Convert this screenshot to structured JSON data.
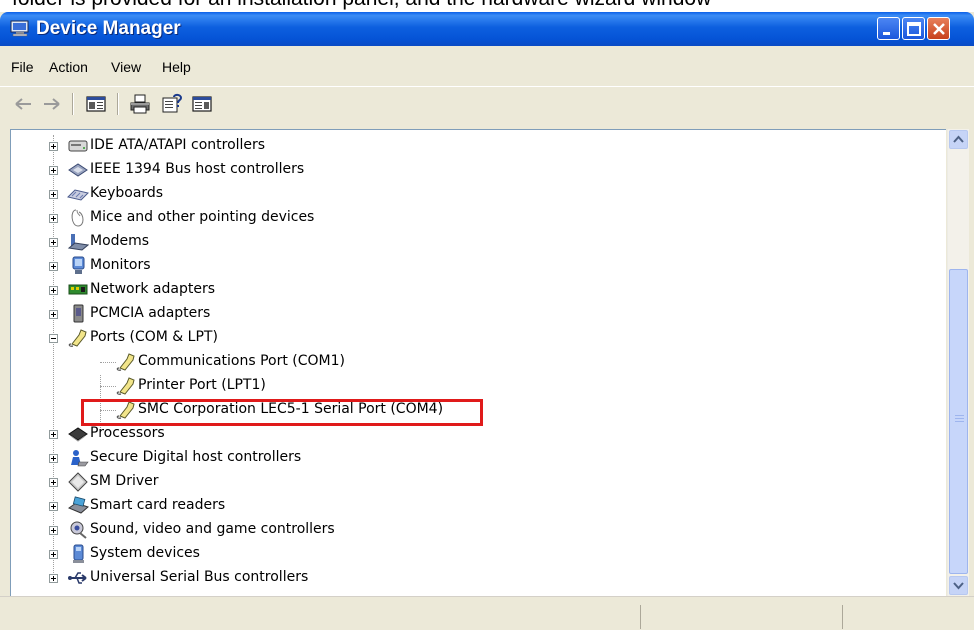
{
  "caption_fragment": "folder is provided for an installation panel, and the hardware wizard window",
  "window": {
    "title": "Device Manager",
    "icon": "computer-monitor-icon",
    "caption_buttons": [
      "minimize",
      "maximize",
      "close"
    ]
  },
  "menu": [
    {
      "label": "File"
    },
    {
      "label": "Action"
    },
    {
      "label": "View"
    },
    {
      "label": "Help"
    }
  ],
  "toolbar": [
    {
      "icon": "back-arrow-icon"
    },
    {
      "icon": "forward-arrow-icon"
    },
    {
      "icon": "show-hide-console-tree-icon"
    },
    {
      "icon": "print-icon"
    },
    {
      "icon": "properties-help-icon"
    },
    {
      "icon": "show-hide-action-pane-icon"
    }
  ],
  "tree": {
    "items": [
      {
        "label": "IDE ATA/ATAPI controllers",
        "icon": "disk-drive-icon",
        "state": "collapsed"
      },
      {
        "label": "IEEE 1394 Bus host controllers",
        "icon": "firewire-icon",
        "state": "collapsed"
      },
      {
        "label": "Keyboards",
        "icon": "keyboard-icon",
        "state": "collapsed"
      },
      {
        "label": "Mice and other pointing devices",
        "icon": "mouse-icon",
        "state": "collapsed"
      },
      {
        "label": "Modems",
        "icon": "modem-icon",
        "state": "collapsed"
      },
      {
        "label": "Monitors",
        "icon": "monitor-icon",
        "state": "collapsed"
      },
      {
        "label": "Network adapters",
        "icon": "network-adapter-icon",
        "state": "collapsed"
      },
      {
        "label": "PCMCIA adapters",
        "icon": "pcmcia-icon",
        "state": "collapsed"
      },
      {
        "label": "Ports (COM & LPT)",
        "icon": "port-connector-icon",
        "state": "expanded",
        "children": [
          {
            "label": "Communications Port (COM1)",
            "icon": "port-connector-icon"
          },
          {
            "label": "Printer Port (LPT1)",
            "icon": "port-connector-icon"
          },
          {
            "label": "SMC Corporation LEC5-1 Serial Port (COM4)",
            "icon": "port-connector-icon",
            "highlighted": true
          }
        ]
      },
      {
        "label": "Processors",
        "icon": "processor-icon",
        "state": "collapsed"
      },
      {
        "label": "Secure Digital host controllers",
        "icon": "sd-card-icon",
        "state": "collapsed"
      },
      {
        "label": "SM Driver",
        "icon": "sm-driver-icon",
        "state": "collapsed"
      },
      {
        "label": "Smart card readers",
        "icon": "smart-card-reader-icon",
        "state": "collapsed"
      },
      {
        "label": "Sound, video and game controllers",
        "icon": "sound-icon",
        "state": "collapsed"
      },
      {
        "label": "System devices",
        "icon": "system-devices-icon",
        "state": "collapsed"
      },
      {
        "label": "Universal Serial Bus controllers",
        "icon": "usb-icon",
        "state": "collapsed"
      }
    ]
  },
  "colors": {
    "titlebar": "#0553d6",
    "highlight_border": "#e01a1a",
    "window_face": "#ece9d8"
  }
}
